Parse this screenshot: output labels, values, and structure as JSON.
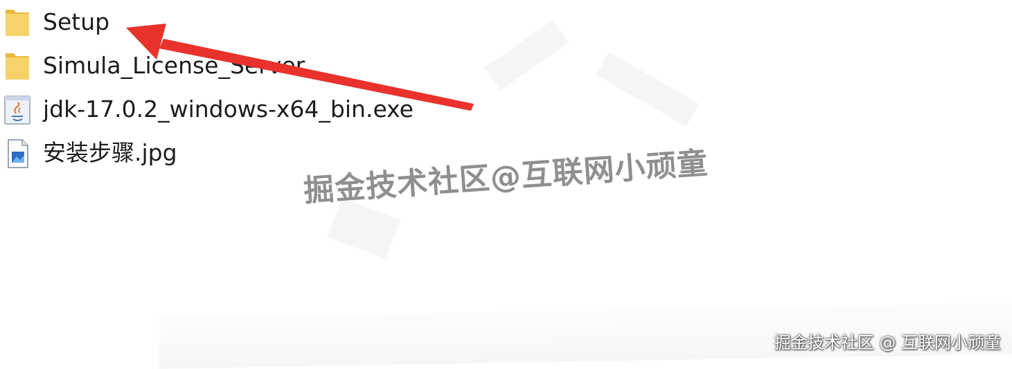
{
  "files": [
    {
      "name": "Setup",
      "icon": "folder-icon",
      "type": "folder"
    },
    {
      "name": "Simula_License_Server",
      "icon": "folder-icon",
      "type": "folder"
    },
    {
      "name": "jdk-17.0.2_windows-x64_bin.exe",
      "icon": "java-exe-icon",
      "type": "executable"
    },
    {
      "name": "安装步骤.jpg",
      "icon": "image-file-icon",
      "type": "image"
    }
  ],
  "watermarks": {
    "center": "掘金技术社区@互联网小顽童",
    "corner": "掘金技术社区 @ 互联网小顽童"
  },
  "colors": {
    "folder": "#f6d26b",
    "folder_dark": "#e8b93f",
    "arrow": "#e8322b",
    "watermark": "#7c7c7c"
  }
}
